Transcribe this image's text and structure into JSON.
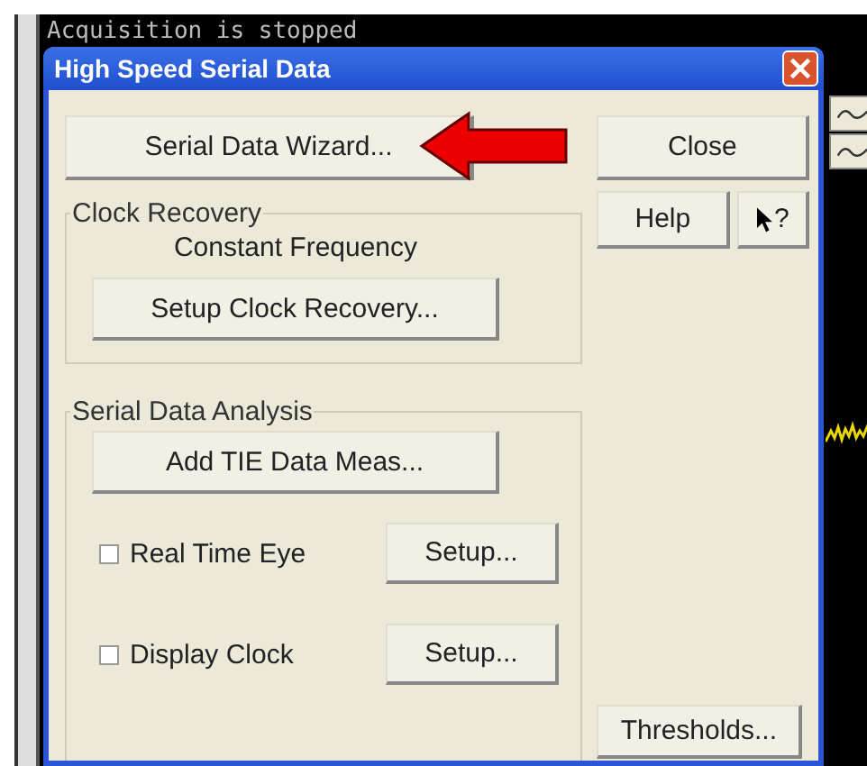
{
  "scope": {
    "status_text": "Acquisition is stopped"
  },
  "dialog": {
    "title": "High Speed Serial Data",
    "wizard_button": "Serial Data Wizard...",
    "close_button": "Close",
    "help_button": "Help",
    "whats_this_button": "?",
    "clock_recovery": {
      "title": "Clock Recovery",
      "mode": "Constant Frequency",
      "setup_button": "Setup Clock Recovery..."
    },
    "serial_data_analysis": {
      "title": "Serial Data Analysis",
      "add_button": "Add TIE Data Meas...",
      "options": [
        {
          "label": "Real Time Eye",
          "checked": false,
          "button": "Setup..."
        },
        {
          "label": "Display Clock",
          "checked": false,
          "button": "Setup..."
        }
      ]
    },
    "thresholds_button": "Thresholds..."
  }
}
